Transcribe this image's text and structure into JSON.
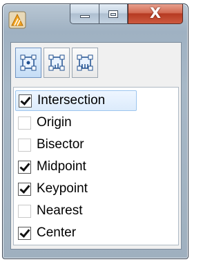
{
  "window": {
    "close_glyph": "X",
    "buttons": [
      "minimize-icon",
      "maximize-icon",
      "close-icon"
    ]
  },
  "toolbar": {
    "tools": [
      {
        "icon": "snap-mode-all-icon",
        "active": true
      },
      {
        "icon": "snap-mode-vertical-icon",
        "active": false
      },
      {
        "icon": "snap-mode-horizontal-icon",
        "active": false
      }
    ]
  },
  "snaps": [
    {
      "label": "Intersection",
      "checked": true,
      "selected": true
    },
    {
      "label": "Origin",
      "checked": false,
      "selected": false
    },
    {
      "label": "Bisector",
      "checked": false,
      "selected": false
    },
    {
      "label": "Midpoint",
      "checked": true,
      "selected": false
    },
    {
      "label": "Keypoint",
      "checked": true,
      "selected": false
    },
    {
      "label": "Nearest",
      "checked": false,
      "selected": false
    },
    {
      "label": "Center",
      "checked": true,
      "selected": false
    }
  ],
  "colors": {
    "accent": "#6f93c2",
    "close": "#c8462c"
  }
}
